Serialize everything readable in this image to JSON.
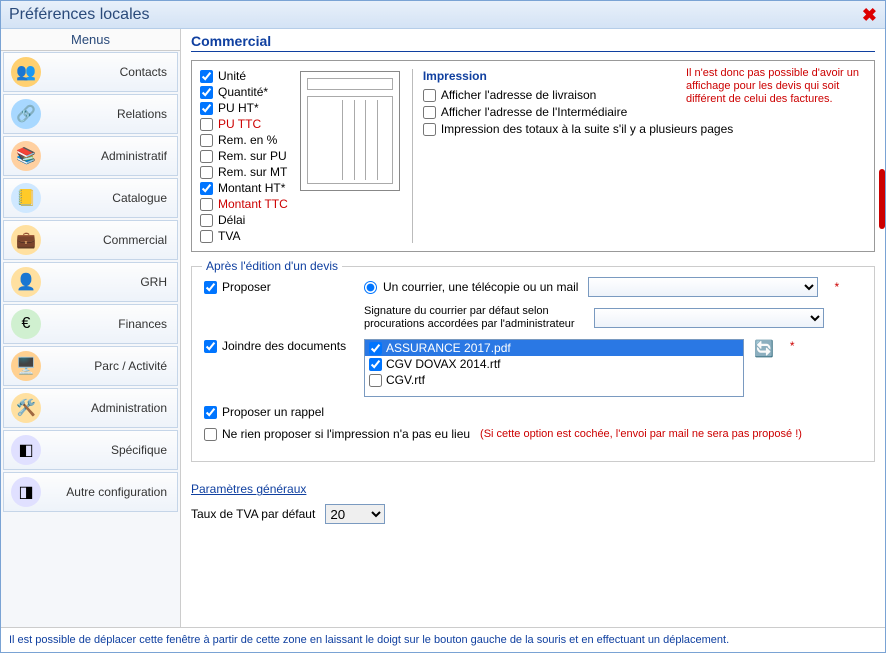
{
  "window": {
    "title": "Préférences locales",
    "menus": "Menus"
  },
  "sidebar": {
    "items": [
      {
        "label": "Contacts"
      },
      {
        "label": "Relations"
      },
      {
        "label": "Administratif"
      },
      {
        "label": "Catalogue"
      },
      {
        "label": "Commercial"
      },
      {
        "label": "GRH"
      },
      {
        "label": "Finances"
      },
      {
        "label": "Parc / Activité"
      },
      {
        "label": "Administration"
      },
      {
        "label": "Spécifique"
      },
      {
        "label": "Autre configuration"
      }
    ]
  },
  "section": {
    "title": "Commercial"
  },
  "line_columns": [
    {
      "label": "Unité",
      "checked": true,
      "red": false
    },
    {
      "label": "Quantité*",
      "checked": true,
      "red": false
    },
    {
      "label": "PU HT*",
      "checked": true,
      "red": false
    },
    {
      "label": "PU TTC",
      "checked": false,
      "red": true
    },
    {
      "label": "Rem. en %",
      "checked": false,
      "red": false
    },
    {
      "label": "Rem. sur PU",
      "checked": false,
      "red": false
    },
    {
      "label": "Rem. sur MT",
      "checked": false,
      "red": false
    },
    {
      "label": "Montant HT*",
      "checked": true,
      "red": false
    },
    {
      "label": "Montant TTC",
      "checked": false,
      "red": true
    },
    {
      "label": "Délai",
      "checked": false,
      "red": false
    },
    {
      "label": "TVA",
      "checked": false,
      "red": false
    }
  ],
  "impression": {
    "title": "Impression",
    "opt1": "Afficher l'adresse de livraison",
    "opt2": "Afficher l'adresse de l'Intermédiaire",
    "opt3": "Impression des totaux à la suite s'il y a plusieurs pages"
  },
  "top_warning": "Il n'est donc pas possible d'avoir un affichage pour les devis qui soit différent de celui des factures.",
  "after_edit": {
    "legend": "Après l'édition d'un devis",
    "proposer": "Proposer",
    "radio": "Un courrier, une télécopie ou un mail",
    "sig": "Signature du courrier par défaut selon procurations accordées par l'administrateur",
    "joindre": "Joindre des documents",
    "docs": [
      {
        "label": "ASSURANCE 2017.pdf",
        "checked": true,
        "sel": true
      },
      {
        "label": "CGV DOVAX 2014.rtf",
        "checked": true,
        "sel": false
      },
      {
        "label": "CGV.rtf",
        "checked": false,
        "sel": false
      }
    ],
    "rappel": "Proposer un rappel",
    "noimpr": "Ne rien proposer si l'impression n'a pas eu lieu",
    "noimpr_note": "(Si cette option est cochée, l'envoi par mail ne sera pas proposé !)"
  },
  "params": {
    "title": "Paramètres généraux",
    "tva_label": "Taux de TVA par défaut",
    "tva_value": "20"
  },
  "footer": "Il est possible de déplacer cette fenêtre à partir de cette zone en laissant le doigt sur le bouton gauche de la souris et en effectuant un déplacement."
}
